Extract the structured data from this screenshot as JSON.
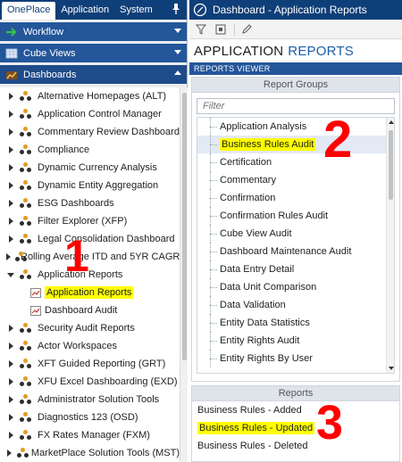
{
  "left_panel": {
    "tabs": [
      "OnePlace",
      "Application",
      "System"
    ],
    "pin_icon": "pin-icon",
    "sections": {
      "workflow": {
        "label": "Workflow",
        "icon": "arrow-right-icon"
      },
      "cube_views": {
        "label": "Cube Views",
        "icon": "cube-icon"
      },
      "dashboards": {
        "label": "Dashboards",
        "icon": "folder-icon"
      }
    },
    "tree": [
      {
        "label": "Alternative Homepages (ALT)"
      },
      {
        "label": "Application Control Manager"
      },
      {
        "label": "Commentary Review Dashboard"
      },
      {
        "label": "Compliance"
      },
      {
        "label": "Dynamic Currency Analysis"
      },
      {
        "label": "Dynamic Entity Aggregation"
      },
      {
        "label": "ESG Dashboards"
      },
      {
        "label": "Filter Explorer (XFP)"
      },
      {
        "label": "Legal Consolidation Dashboard"
      },
      {
        "label": "Rolling Average ITD and 5YR CAGR"
      },
      {
        "label": "Application Reports"
      },
      {
        "label": "Application Reports"
      },
      {
        "label": "Dashboard Audit"
      },
      {
        "label": "Security Audit Reports"
      },
      {
        "label": "Actor Workspaces"
      },
      {
        "label": "XFT Guided Reporting (GRT)"
      },
      {
        "label": "XFU Excel Dashboarding (EXD)"
      },
      {
        "label": "Administrator Solution Tools"
      },
      {
        "label": "Diagnostics 123 (OSD)"
      },
      {
        "label": "FX Rates Manager (FXM)"
      },
      {
        "label": "MarketPlace Solution Tools (MST)"
      }
    ]
  },
  "right_panel": {
    "title": "Dashboard - Application Reports",
    "heading_part1": "APPLICATION",
    "heading_part2": "REPORTS",
    "viewer_label": "REPORTS VIEWER",
    "report_groups": {
      "header": "Report Groups",
      "filter_placeholder": "Filter",
      "items": [
        "Application Analysis",
        "Business Rules Audit",
        "Certification",
        "Commentary",
        "Confirmation",
        "Confirmation Rules Audit",
        "Cube View Audit",
        "Dashboard Maintenance Audit",
        "Data Entry Detail",
        "Data Unit Comparison",
        "Data Validation",
        "Entity Data Statistics",
        "Entity Rights Audit",
        "Entity Rights By User"
      ]
    },
    "reports": {
      "header": "Reports",
      "items": [
        "Business Rules - Added",
        "Business Rules - Updated",
        "Business Rules - Deleted"
      ]
    }
  },
  "annotations": {
    "step1": "1",
    "step2": "2",
    "step3": "3",
    "highlight_color": "#ffff00",
    "number_color": "#ff0000"
  }
}
